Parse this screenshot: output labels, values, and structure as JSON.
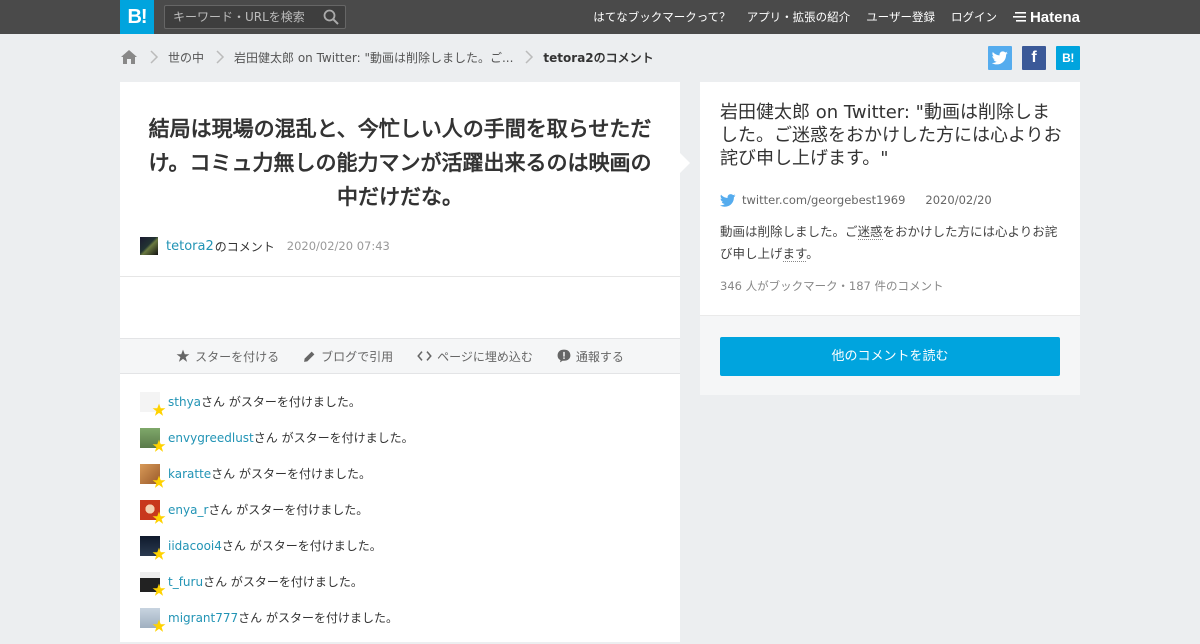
{
  "header": {
    "logo_text": "B!",
    "search_placeholder": "キーワード・URLを検索",
    "nav": [
      {
        "label": "はてなブックマークって？"
      },
      {
        "label": "アプリ・拡張の紹介"
      },
      {
        "label": "ユーザー登録"
      },
      {
        "label": "ログイン"
      }
    ],
    "brand": "Hatena"
  },
  "breadcrumb": {
    "items": [
      "世の中",
      "岩田健太郎 on Twitter: \"動画は削除しました。ご...",
      "tetora2のコメント"
    ]
  },
  "share": {
    "hatena_label": "B!",
    "facebook_label": "f"
  },
  "comment": {
    "text": "結局は現場の混乱と、今忙しい人の手間を取らせただけ。コミュ力無しの能力マンが活躍出来るのは映画の中だけだな。",
    "user": "tetora2",
    "user_suffix": "のコメント",
    "date": "2020/02/20 07:43"
  },
  "actions": [
    {
      "label": "スターを付ける",
      "icon": "star-icon"
    },
    {
      "label": "ブログで引用",
      "icon": "pencil-icon"
    },
    {
      "label": "ページに埋め込む",
      "icon": "code-icon"
    },
    {
      "label": "通報する",
      "icon": "report-icon"
    }
  ],
  "stars": {
    "suffix": "さん がスターを付けました。",
    "users": [
      {
        "name": "sthya",
        "avatar_color": "#f4f4f4"
      },
      {
        "name": "envygreedlust",
        "avatar_color": "#6f8f5a"
      },
      {
        "name": "karatte",
        "avatar_color": "#c9844a"
      },
      {
        "name": "enya_r",
        "avatar_color": "#d64a2a"
      },
      {
        "name": "iidacooi4",
        "avatar_color": "#1b2a3e"
      },
      {
        "name": "t_furu",
        "avatar_color": "#2e2e2e"
      },
      {
        "name": "migrant777",
        "avatar_color": "#b8c4d0"
      }
    ],
    "star_color": "#ffd200"
  },
  "entry": {
    "title": "岩田健太郎 on Twitter: \"動画は削除しました。ご迷惑をおかけした方には心よりお詫び申し上げます。\"",
    "domain": "twitter.com/georgebest1969",
    "date": "2020/02/20",
    "summary_parts": [
      "動画は削除しました。ご",
      "迷惑",
      "をおかけした方には心よりお詫び申し上げ",
      "ます",
      "。"
    ],
    "count": "346 人がブックマーク・187 件のコメント",
    "read_more": "他のコメントを読む"
  },
  "colors": {
    "accent": "#00a4de",
    "link": "#2294b5",
    "header_bg": "#4a4a4a",
    "twitter": "#55acee",
    "facebook": "#3b5998"
  }
}
